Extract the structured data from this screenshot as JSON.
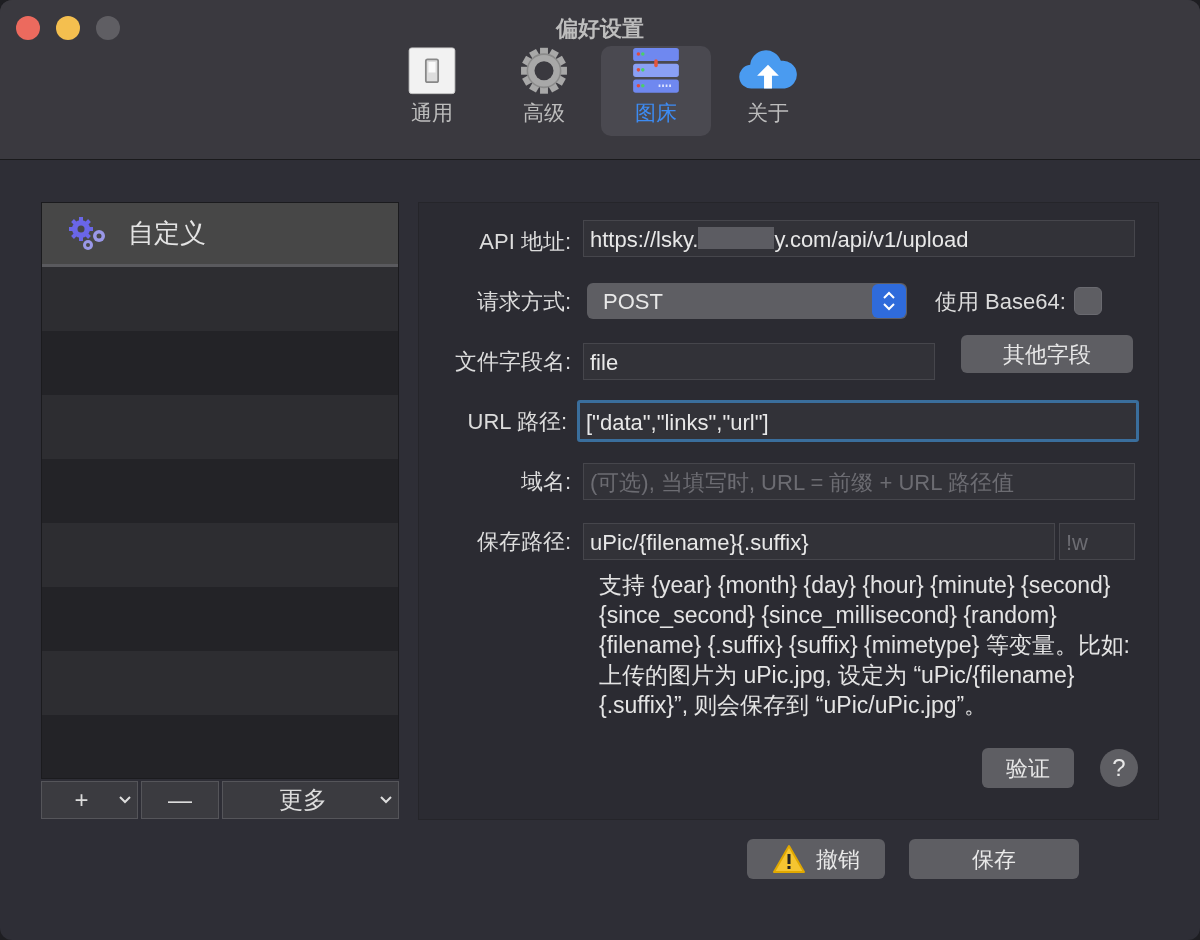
{
  "window": {
    "title": "偏好设置",
    "controls": [
      {
        "kind": "close",
        "disabled": false
      },
      {
        "kind": "minimize",
        "disabled": false
      },
      {
        "kind": "zoom",
        "disabled": true
      }
    ]
  },
  "tabs": [
    {
      "label": "通用",
      "kind": "switch",
      "selected": false
    },
    {
      "label": "高级",
      "kind": "gear",
      "selected": false
    },
    {
      "label": "图床",
      "kind": "server",
      "selected": true
    },
    {
      "label": "关于",
      "kind": "cloud",
      "selected": false
    }
  ],
  "uploaders": [
    {
      "label": "自定义",
      "selected": true
    }
  ],
  "list_buttons": [
    {
      "label": "+",
      "dropdown": true
    },
    {
      "label": "—",
      "dropdown": false
    },
    {
      "label": "更多",
      "dropdown": true
    }
  ],
  "form": {
    "api_url": {
      "label": "API 地址:",
      "value_parts": [
        "https://lsky.",
        "y.com/api/v1/upload"
      ]
    },
    "method": {
      "label": "请求方式:",
      "value": "POST"
    },
    "base64": {
      "label": "使用 Base64:",
      "checked": false
    },
    "file_field": {
      "label": "文件字段名:",
      "value": "file",
      "button": "其他字段"
    },
    "url_path": {
      "label": "URL 路径:",
      "value": "[\"data\",\"links\",\"url\"]",
      "focused": true
    },
    "domain": {
      "label": "域名:",
      "placeholder": "(可选), 当填写时, URL = 前缀 + URL 路径值"
    },
    "save_path": {
      "label": "保存路径:",
      "value": "uPic/{filename}{.suffix}",
      "suffix_placeholder": "!w",
      "help": "支持 {year} {month} {day} {hour} {minute} {second} {since_second} {since_millisecond} {random} {filename} {.suffix} {suffix} {mimetype} 等变量。比如: 上传的图片为 uPic.jpg, 设定为 “uPic/{filename}{.suffix}”, 则会保存到 “uPic/uPic.jpg”。"
    },
    "verify_button": "验证",
    "help_button": "?"
  },
  "footer_buttons": [
    {
      "label": "撤销",
      "kind": "warning"
    },
    {
      "label": "保存",
      "kind": "plain"
    }
  ]
}
